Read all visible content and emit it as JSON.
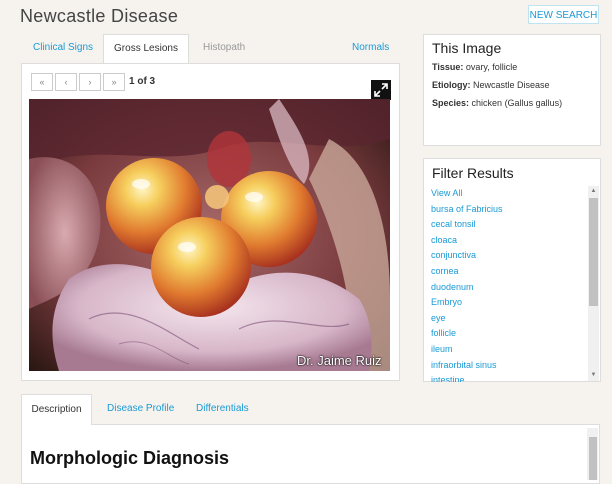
{
  "page_title": "Newcastle Disease",
  "new_search_label": "NEW SEARCH",
  "image_tabs": [
    {
      "label": "Clinical Signs"
    },
    {
      "label": "Gross Lesions"
    },
    {
      "label": "Histopath"
    },
    {
      "label": "Normals"
    }
  ],
  "pager": {
    "first": "«",
    "prev": "‹",
    "next": "›",
    "last": "»",
    "count": "1 of 3"
  },
  "photo": {
    "credit": "Dr. Jaime Ruiz"
  },
  "this_image": {
    "title": "This Image",
    "tissue_label": "Tissue:",
    "tissue_value": "ovary, follicle",
    "etiology_label": "Etiology:",
    "etiology_value": "Newcastle Disease",
    "species_label": "Species:",
    "species_value": "chicken (Gallus gallus)"
  },
  "filter": {
    "title": "Filter Results",
    "items": [
      "View All",
      "bursa of Fabricius",
      "cecal tonsil",
      "cloaca",
      "conjunctiva",
      "cornea",
      "duodenum",
      "Embryo",
      "eye",
      "follicle",
      "ileum",
      "infraorbital sinus",
      "intestine"
    ]
  },
  "bottom_tabs": [
    {
      "label": "Description"
    },
    {
      "label": "Disease Profile"
    },
    {
      "label": "Differentials"
    }
  ],
  "section_heading": "Morphologic Diagnosis",
  "colors": {
    "link": "#1a9ad6",
    "background": "#f6f3ee"
  }
}
